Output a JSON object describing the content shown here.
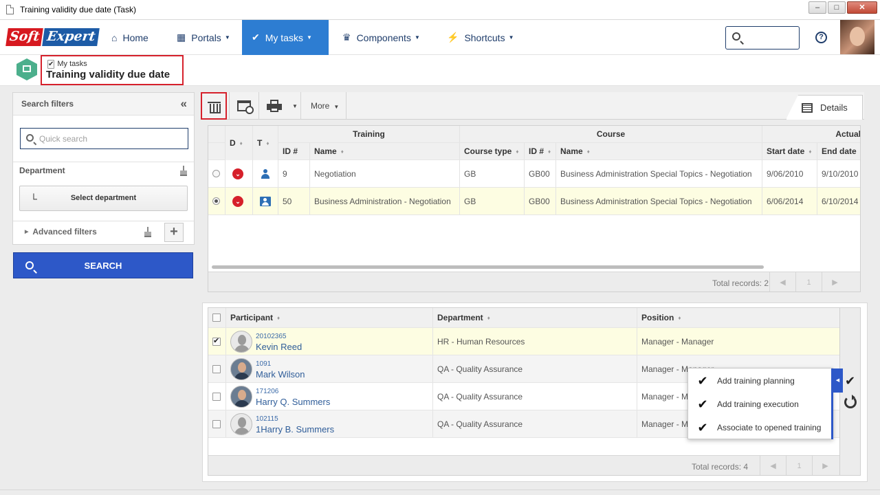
{
  "window": {
    "title": "Training validity due date (Task)"
  },
  "nav": {
    "logo_soft": "Soft",
    "logo_expert": "Expert",
    "items": [
      {
        "label": "Home",
        "icon": "home-icon"
      },
      {
        "label": "Portals",
        "icon": "portals-icon"
      },
      {
        "label": "My tasks",
        "icon": "check-icon",
        "active": true
      },
      {
        "label": "Components",
        "icon": "trophy-icon"
      },
      {
        "label": "Shortcuts",
        "icon": "lightning-icon"
      }
    ],
    "help": "?"
  },
  "breadcrumb": {
    "parent": "My tasks",
    "title": "Training validity due date"
  },
  "filters": {
    "title": "Search filters",
    "quick_placeholder": "Quick search",
    "department_label": "Department",
    "select_department": "Select department",
    "advanced": "Advanced filters",
    "search_button": "SEARCH"
  },
  "toolbar": {
    "more": "More",
    "details_tab": "Details"
  },
  "training_grid": {
    "group_headers": {
      "training": "Training",
      "course": "Course",
      "actual": "Actual"
    },
    "headers": {
      "d": "D",
      "t": "T",
      "id": "ID #",
      "name": "Name",
      "course_type": "Course type",
      "course_id": "ID #",
      "course_name": "Name",
      "start": "Start date",
      "end": "End date"
    },
    "rows": [
      {
        "id": "9",
        "name": "Negotiation",
        "course_type": "GB",
        "course_id": "GB00",
        "course_name": "Business Administration Special Topics - Negotiation",
        "start": "9/06/2010",
        "end": "9/10/2010",
        "selected": false
      },
      {
        "id": "50",
        "name": "Business Administration - Negotiation",
        "course_type": "GB",
        "course_id": "GB00",
        "course_name": "Business Administration Special Topics - Negotiation",
        "start": "6/06/2014",
        "end": "6/10/2014",
        "selected": true
      }
    ],
    "total": "Total records: 2",
    "page": "1"
  },
  "participants_grid": {
    "headers": {
      "participant": "Participant",
      "department": "Department",
      "position": "Position"
    },
    "rows": [
      {
        "id": "20102365",
        "name": "Kevin Reed",
        "department": "HR - Human Resources",
        "position": "Manager - Manager",
        "checked": true,
        "photo": false
      },
      {
        "id": "1091",
        "name": "Mark Wilson",
        "department": "QA - Quality Assurance",
        "position": "Manager - Manager",
        "checked": false,
        "photo": true
      },
      {
        "id": "171206",
        "name": "Harry Q. Summers",
        "department": "QA - Quality Assurance",
        "position": "Manager - Manager",
        "checked": false,
        "photo": true
      },
      {
        "id": "102115",
        "name": "1Harry B. Summers",
        "department": "QA - Quality Assurance",
        "position": "Manager - Manager",
        "checked": false,
        "photo": false
      }
    ],
    "total": "Total records: 4",
    "page": "1"
  },
  "popup_menu": {
    "items": [
      {
        "label": "Add training planning"
      },
      {
        "label": "Add training execution"
      },
      {
        "label": "Associate to opened training"
      }
    ]
  }
}
